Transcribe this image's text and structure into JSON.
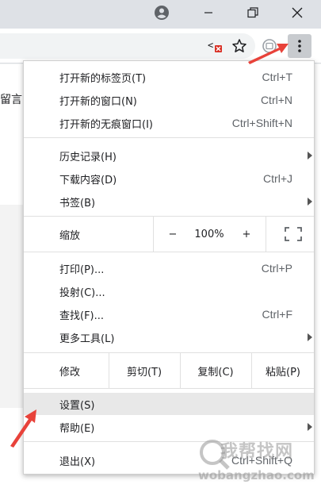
{
  "page": {
    "side_text": "留言"
  },
  "menu": {
    "items_top": [
      {
        "label": "打开新的标签页(T)",
        "shortcut": "Ctrl+T"
      },
      {
        "label": "打开新的窗口(N)",
        "shortcut": "Ctrl+N"
      },
      {
        "label": "打开新的无痕窗口(I)",
        "shortcut": "Ctrl+Shift+N"
      }
    ],
    "items_history": [
      {
        "label": "历史记录(H)",
        "shortcut": ""
      },
      {
        "label": "下载内容(D)",
        "shortcut": "Ctrl+J"
      },
      {
        "label": "书签(B)",
        "shortcut": ""
      }
    ],
    "zoom": {
      "label": "缩放",
      "minus": "−",
      "value": "100%",
      "plus": "+"
    },
    "items_tools": [
      {
        "label": "打印(P)...",
        "shortcut": "Ctrl+P"
      },
      {
        "label": "投射(C)...",
        "shortcut": ""
      },
      {
        "label": "查找(F)...",
        "shortcut": "Ctrl+F"
      },
      {
        "label": "更多工具(L)",
        "shortcut": ""
      }
    ],
    "edit": {
      "label": "修改",
      "cut": "剪切(T)",
      "copy": "复制(C)",
      "paste": "粘贴(P)"
    },
    "settings": {
      "label": "设置(S)"
    },
    "help": {
      "label": "帮助(E)"
    },
    "exit": {
      "label": "退出(X)",
      "shortcut": "Ctrl+Shift+Q"
    }
  },
  "watermark": {
    "text": "我帮找网",
    "url": "wobangzhao.com"
  },
  "colors": {
    "annotation_arrow": "#e8423a",
    "menu_highlight": "#e8e8e8",
    "menu_button_bg": "#c8cbcf"
  }
}
